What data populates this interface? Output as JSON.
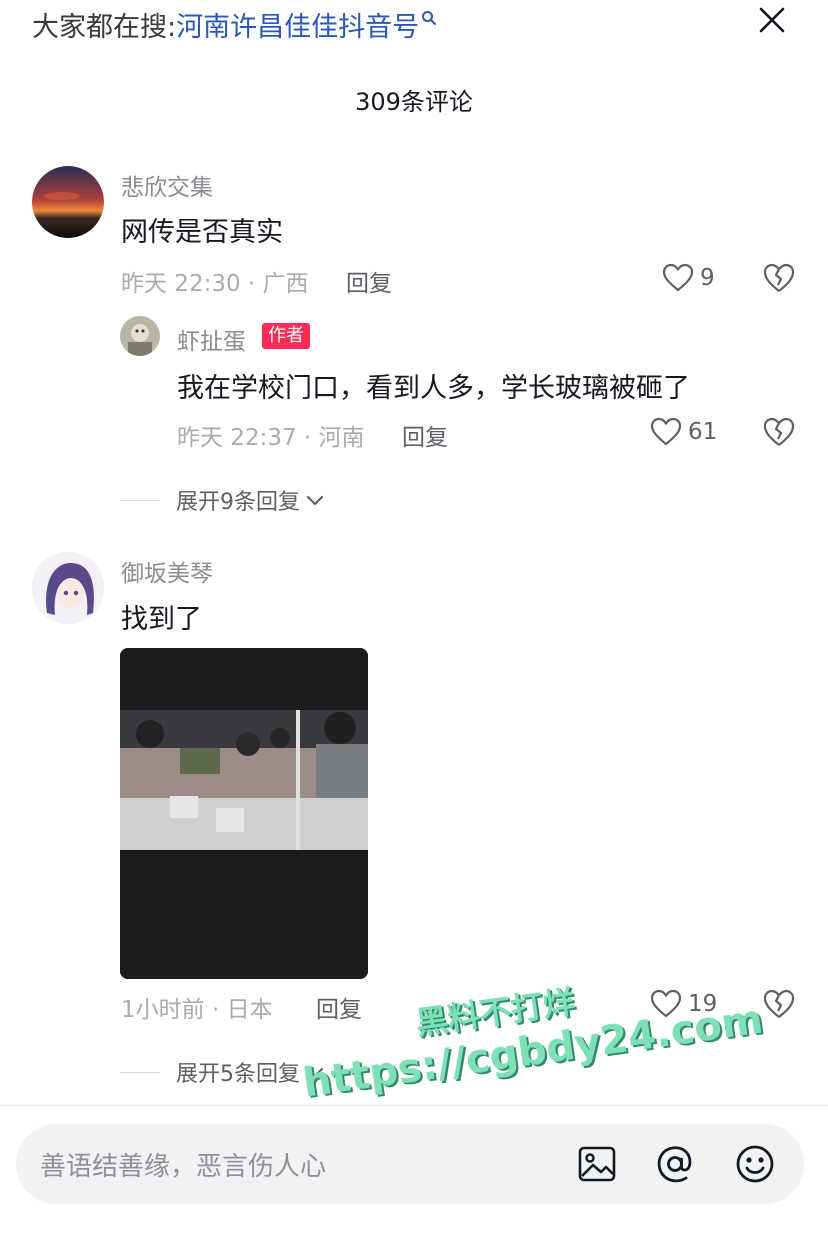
{
  "header": {
    "search_prefix": "大家都在搜:",
    "search_term": "河南许昌佳佳抖音号",
    "comment_count": "309条评论"
  },
  "comments": [
    {
      "username": "悲欣交集",
      "text": "网传是否真实",
      "meta": "昨天 22:30 · 广西",
      "reply_label": "回复",
      "likes": "9",
      "replies": [
        {
          "username": "虾扯蛋",
          "badge": "作者",
          "text": "我在学校门口，看到人多，学长玻璃被砸了",
          "meta": "昨天 22:37 · 河南",
          "reply_label": "回复",
          "likes": "61"
        }
      ],
      "expand_label": "展开9条回复"
    },
    {
      "username": "御坂美琴",
      "text": "找到了",
      "meta": "1小时前 · 日本",
      "reply_label": "回复",
      "likes": "19",
      "expand_label": "展开5条回复"
    }
  ],
  "input": {
    "placeholder": "善语结善缘，恶言伤人心",
    "icons": [
      "image-icon",
      "mention-icon",
      "emoji-icon"
    ]
  },
  "watermark": {
    "line1": "黑料不打烊",
    "line2": "https://cgbdy24.com"
  },
  "colors": {
    "accent": "#fe2c55",
    "link": "#2b57b8",
    "muted": "#a9abb0"
  }
}
